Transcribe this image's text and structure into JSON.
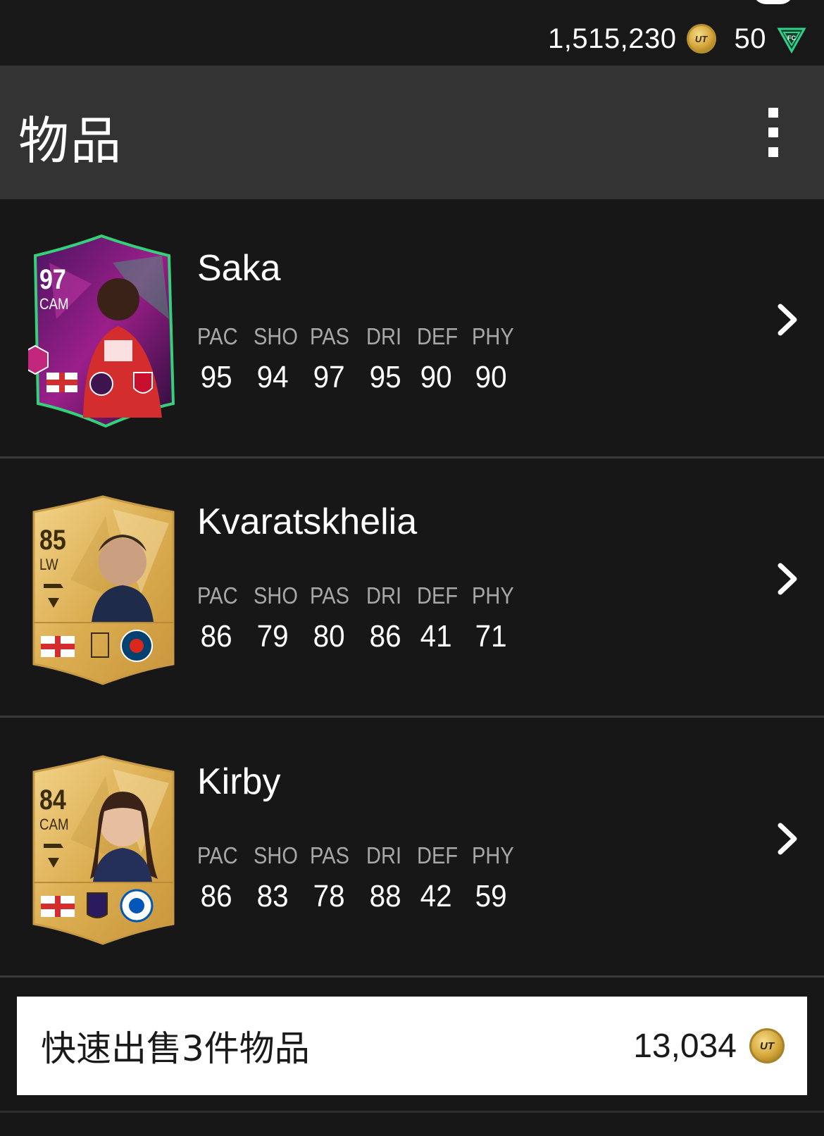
{
  "currency": {
    "coins": "1,515,230",
    "coin_icon_text": "UT",
    "points": "50",
    "points_icon": "fc-points-icon"
  },
  "header": {
    "title": "物品",
    "menu_icon": "more-vertical-icon"
  },
  "stat_labels": [
    "PAC",
    "SHO",
    "PAS",
    "DRI",
    "DEF",
    "PHY"
  ],
  "items": [
    {
      "name": "Saka",
      "rating": "97",
      "position": "CAM",
      "card_style": "special",
      "stats": [
        "95",
        "94",
        "97",
        "95",
        "90",
        "90"
      ]
    },
    {
      "name": "Kvaratskhelia",
      "rating": "85",
      "position": "LW",
      "card_style": "gold",
      "stats": [
        "86",
        "79",
        "80",
        "86",
        "41",
        "71"
      ]
    },
    {
      "name": "Kirby",
      "rating": "84",
      "position": "CAM",
      "card_style": "gold",
      "stats": [
        "86",
        "83",
        "78",
        "88",
        "42",
        "59"
      ]
    }
  ],
  "quick_sell": {
    "label": "快速出售3件物品",
    "value": "13,034",
    "coin_icon_text": "UT"
  },
  "colors": {
    "background": "#171717",
    "header": "#333333",
    "gold_card": "#e3b85a",
    "special_card": "#7a1f7a",
    "stat_label": "#a8a8a8"
  }
}
